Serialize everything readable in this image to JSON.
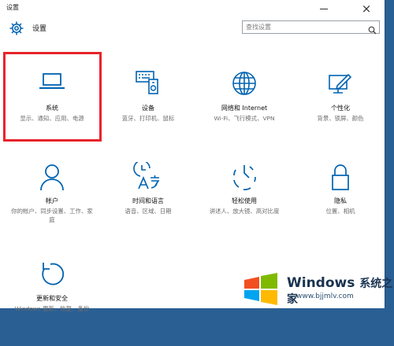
{
  "window": {
    "title": "设置"
  },
  "header": {
    "title": "设置"
  },
  "search": {
    "placeholder": "查找设置"
  },
  "tiles": [
    {
      "label": "系统",
      "desc": "显示、通知、应用、电源",
      "icon": "laptop-icon"
    },
    {
      "label": "设备",
      "desc": "蓝牙、打印机、鼠标",
      "icon": "devices-icon"
    },
    {
      "label": "网络和 Internet",
      "desc": "Wi-Fi、飞行模式、VPN",
      "icon": "globe-icon"
    },
    {
      "label": "个性化",
      "desc": "背景、锁屏、颜色",
      "icon": "personalization-icon"
    },
    {
      "label": "帐户",
      "desc": "你的帐户、同步设置、工作、家庭",
      "icon": "person-icon"
    },
    {
      "label": "时间和语言",
      "desc": "语音、区域、日期",
      "icon": "time-language-icon"
    },
    {
      "label": "轻松使用",
      "desc": "讲述人、放大镜、高对比度",
      "icon": "ease-of-access-icon"
    },
    {
      "label": "隐私",
      "desc": "位置、相机",
      "icon": "lock-icon"
    },
    {
      "label": "更新和安全",
      "desc": "Windows 更新、恢复、备份",
      "icon": "update-icon"
    }
  ],
  "watermark": {
    "brand": "Windows",
    "suffix": "系统之家",
    "url": "www.bjjmlv.com"
  },
  "colors": {
    "accent": "#0063b1",
    "highlight": "#e8232b"
  }
}
